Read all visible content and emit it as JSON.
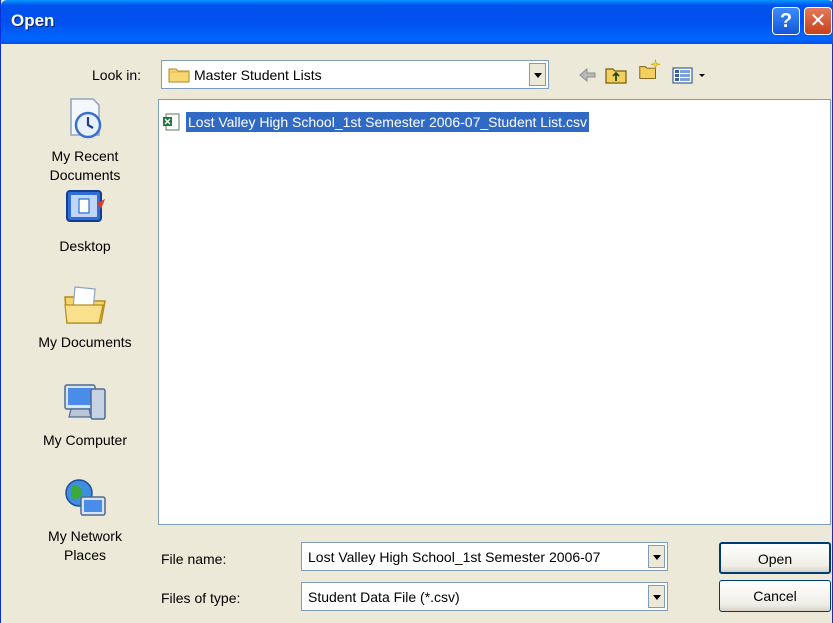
{
  "window": {
    "title": "Open",
    "help_glyph": "?",
    "close_glyph": "✕"
  },
  "lookin": {
    "label": "Look in:",
    "value": "Master Student Lists",
    "icon": "folder-icon"
  },
  "toolbar": {
    "icons": [
      "back-arrow-icon",
      "up-one-level-icon",
      "create-new-folder-icon",
      "view-menu-icon"
    ]
  },
  "places": [
    {
      "label": "My Recent Documents",
      "line1": "My Recent",
      "line2": "Documents",
      "icon": "recent-documents-icon"
    },
    {
      "label": "Desktop",
      "line1": "Desktop",
      "line2": "",
      "icon": "desktop-icon"
    },
    {
      "label": "My Documents",
      "line1": "My Documents",
      "line2": "",
      "icon": "my-documents-icon"
    },
    {
      "label": "My Computer",
      "line1": "My Computer",
      "line2": "",
      "icon": "my-computer-icon"
    },
    {
      "label": "My Network Places",
      "line1": "My Network",
      "line2": "Places",
      "icon": "network-places-icon"
    }
  ],
  "files": [
    {
      "name": "Lost Valley High School_1st Semester 2006-07_Student List.csv",
      "icon": "csv-file-icon",
      "selected": true
    }
  ],
  "filename": {
    "label": "File name:",
    "value": "Lost Valley High School_1st Semester 2006-07"
  },
  "filetype": {
    "label": "Files of type:",
    "value": "Student Data File (*.csv)"
  },
  "buttons": {
    "open": "Open",
    "cancel": "Cancel"
  },
  "colors": {
    "titlebar": "#0053EE",
    "selection": "#316AC5",
    "dialog_bg": "#ECE9D8"
  }
}
